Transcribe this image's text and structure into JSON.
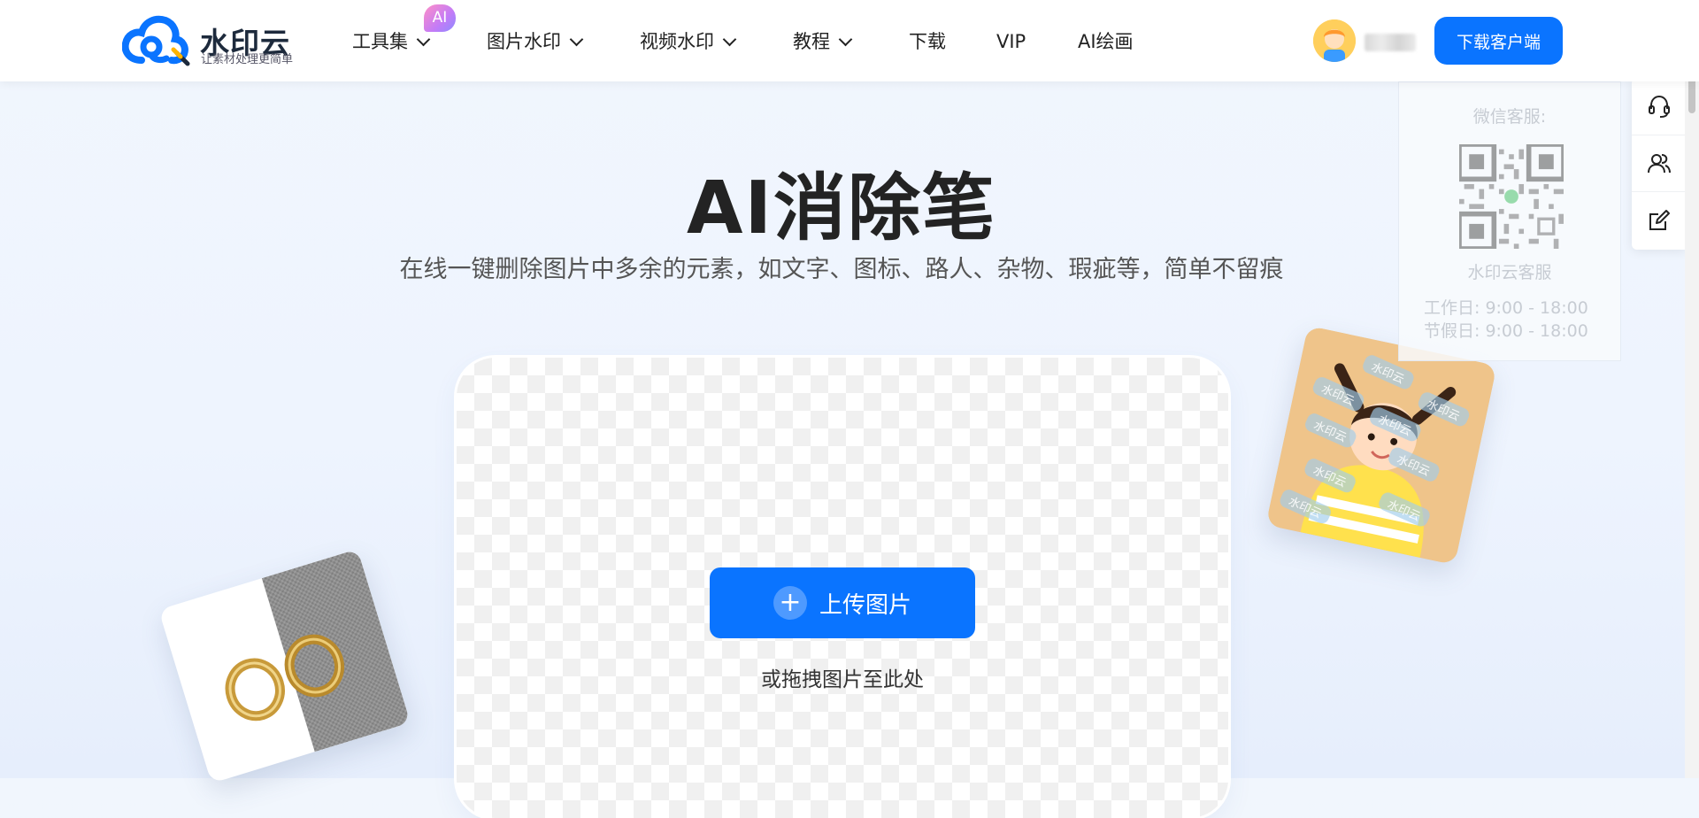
{
  "header": {
    "logo": {
      "name": "水印云",
      "slogan": "让素材处理更简单"
    },
    "nav": [
      {
        "label": "工具集",
        "has_dropdown": true,
        "badge": "AI"
      },
      {
        "label": "图片水印",
        "has_dropdown": true
      },
      {
        "label": "视频水印",
        "has_dropdown": true
      },
      {
        "label": "教程",
        "has_dropdown": true
      },
      {
        "label": "下载",
        "has_dropdown": false
      },
      {
        "label": "VIP",
        "has_dropdown": false
      },
      {
        "label": "AI绘画",
        "has_dropdown": false
      }
    ],
    "download_button": "下载客户端"
  },
  "hero": {
    "title": "AI消除笔",
    "subtitle": "在线一键删除图片中多余的元素，如文字、图标、路人、杂物、瑕疵等，简单不留痕"
  },
  "upload": {
    "button_label": "上传图片",
    "drag_hint": "或拖拽图片至此处"
  },
  "decor": {
    "watermark_text": "水印云"
  },
  "service": {
    "title": "微信客服:",
    "name": "水印云客服",
    "workday": "工作日:  9:00 - 18:00",
    "holiday": "节假日:  9:00 - 18:00"
  },
  "side_toolbar": {
    "icons": [
      "headset-icon",
      "users-icon",
      "edit-icon"
    ]
  },
  "colors": {
    "accent": "#0a74ff",
    "title_text": "#232323",
    "page_bg": "#f1f6fd"
  }
}
